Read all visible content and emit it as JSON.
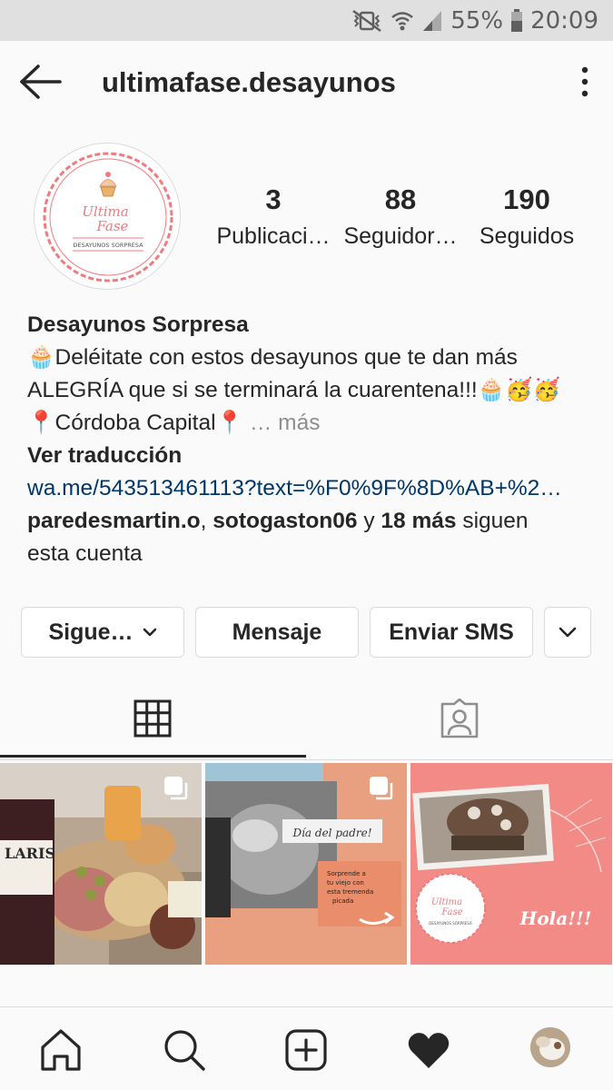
{
  "status_bar": {
    "battery": "55%",
    "time": "20:09"
  },
  "header": {
    "username": "ultimafase.desayunos"
  },
  "avatar_logo": {
    "line1": "Ultima",
    "line2": "Fase",
    "tagline": "DESAYUNOS SORPRESA"
  },
  "stats": [
    {
      "value": "3",
      "label": "Publicaci…"
    },
    {
      "value": "88",
      "label": "Seguidor…"
    },
    {
      "value": "190",
      "label": "Seguidos"
    }
  ],
  "bio": {
    "name": "Desayunos Sorpresa",
    "line1": "🧁Deléitate con estos desayunos que te dan más",
    "line2": "ALEGRÍA que si se terminará la cuarentena!!!🧁🥳🥳",
    "line3": "📍Córdoba Capital📍",
    "more": "… más",
    "translate": "Ver traducción",
    "link": "wa.me/543513461113?text=%F0%9F%8D%AB+%2…",
    "followed_user1": "paredesmartin.o",
    "sep": ", ",
    "followed_user2": "sotogaston06",
    "and": " y ",
    "followed_more": "18 más",
    "followed_suffix": " siguen",
    "followed_line2": "esta cuenta"
  },
  "buttons": {
    "following": "Sigue…",
    "message": "Mensaje",
    "sms": "Enviar SMS"
  },
  "posts": {
    "post1": {
      "bottle_label": "LARIS"
    },
    "post2": {
      "title": "Día del padre!",
      "line1": "Sorprende a",
      "line2": "tu viejo con",
      "line3": "esta tremenda",
      "line4": "picada"
    },
    "post3": {
      "greeting": "Hola!!!",
      "logo1": "Ultima",
      "logo2": "Fase",
      "logo_tag": "DESAYUNOS SORPRESA"
    }
  },
  "colors": {
    "link": "#00376b",
    "logo_pink": "#ef7b7f",
    "post3_bg": "#f28b86",
    "text": "#262626",
    "muted": "#8e8e8e"
  }
}
